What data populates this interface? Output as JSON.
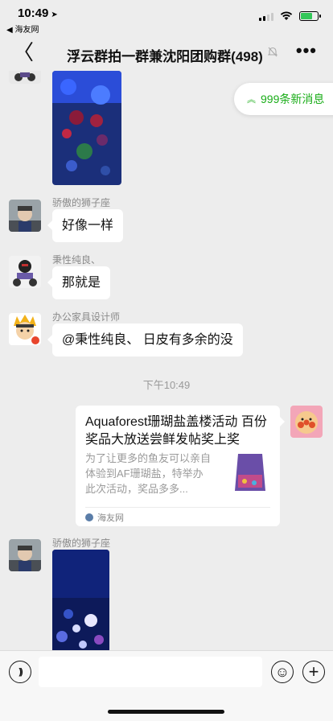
{
  "status_bar": {
    "time": "10:49",
    "location_arrow": "➤",
    "back_app": "◀ 海友网"
  },
  "nav": {
    "back_glyph": "〈",
    "title": "浮云群拍一群兼沈阳团购群(498)",
    "mute_icon": "bell-off-icon",
    "more_glyph": "•••"
  },
  "new_messages": {
    "arrow": "︽",
    "label": "999条新消息",
    "color": "#1aad19"
  },
  "messages": [
    {
      "type": "image",
      "sender": ""
    },
    {
      "type": "text",
      "sender": "骄傲的狮子座",
      "text": "好像一样"
    },
    {
      "type": "text",
      "sender": "秉性纯良、",
      "text": "那就是"
    },
    {
      "type": "text",
      "sender": "办公家具设计师",
      "text": "@秉性纯良、 日皮有多余的没"
    }
  ],
  "timestamp": "下午10:49",
  "link_card": {
    "title": "Aquaforest珊瑚盐盖楼活动 百份奖品大放送尝鲜发帖奖上奖",
    "description": "为了让更多的鱼友可以亲自体验到AF珊瑚盐，特举办此次活动，奖品多多...",
    "source": "海友网"
  },
  "last_message": {
    "type": "image",
    "sender": "骄傲的狮子座"
  },
  "input_bar": {
    "voice_glyph": "))",
    "emoji_glyph": "☺",
    "plus_glyph": "+"
  }
}
